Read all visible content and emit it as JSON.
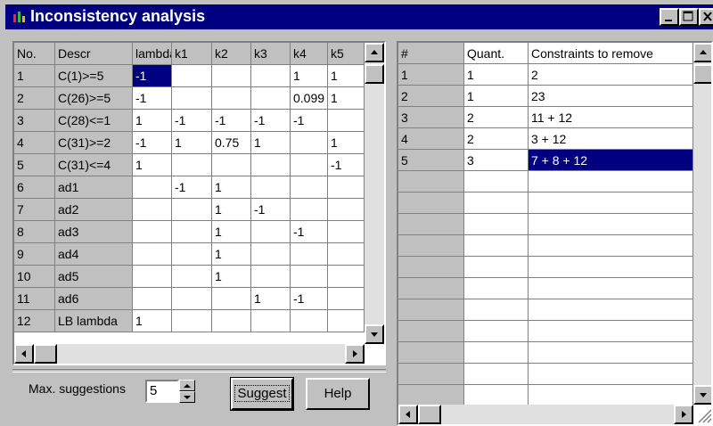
{
  "window": {
    "title": "Inconsistency analysis",
    "minimize_icon": "minimize-icon",
    "maximize_icon": "maximize-icon",
    "close_icon": "close-icon"
  },
  "left_grid": {
    "headers": [
      "No.",
      "Descr",
      "lambda",
      "k1",
      "k2",
      "k3",
      "k4",
      "k5"
    ],
    "rows": [
      [
        "1",
        "C(1)>=5",
        "-1",
        "",
        "",
        "",
        "1",
        "1"
      ],
      [
        "2",
        "C(26)>=5",
        "-1",
        "",
        "",
        "",
        "0.099",
        "1"
      ],
      [
        "3",
        "C(28)<=1",
        "1",
        "-1",
        "-1",
        "-1",
        "-1",
        ""
      ],
      [
        "4",
        "C(31)>=2",
        "-1",
        "1",
        "0.75",
        "1",
        "",
        "1"
      ],
      [
        "5",
        "C(31)<=4",
        "1",
        "",
        "",
        "",
        "",
        "-1"
      ],
      [
        "6",
        "ad1",
        "",
        "-1",
        "1",
        "",
        "",
        ""
      ],
      [
        "7",
        "ad2",
        "",
        "",
        "1",
        "-1",
        "",
        ""
      ],
      [
        "8",
        "ad3",
        "",
        "",
        "1",
        "",
        "-1",
        ""
      ],
      [
        "9",
        "ad4",
        "",
        "",
        "1",
        "",
        "",
        ""
      ],
      [
        "10",
        "ad5",
        "",
        "",
        "1",
        "",
        "",
        ""
      ],
      [
        "11",
        "ad6",
        "",
        "",
        "",
        "1",
        "-1",
        ""
      ],
      [
        "12",
        "LB lambda",
        "1",
        "",
        "",
        "",
        "",
        ""
      ]
    ]
  },
  "right_grid": {
    "headers": [
      "#",
      "Quant.",
      "Constraints to remove"
    ],
    "rows": [
      [
        "1",
        "1",
        "2"
      ],
      [
        "2",
        "1",
        "23"
      ],
      [
        "3",
        "2",
        "11 + 12"
      ],
      [
        "4",
        "2",
        "3 + 12"
      ],
      [
        "5",
        "3",
        "7 + 8 + 12"
      ],
      [
        "",
        "",
        ""
      ],
      [
        "",
        "",
        ""
      ],
      [
        "",
        "",
        ""
      ],
      [
        "",
        "",
        ""
      ],
      [
        "",
        "",
        ""
      ],
      [
        "",
        "",
        ""
      ],
      [
        "",
        "",
        ""
      ],
      [
        "",
        "",
        ""
      ],
      [
        "",
        "",
        ""
      ],
      [
        "",
        "",
        ""
      ],
      [
        "",
        "",
        ""
      ],
      [
        "",
        "",
        ""
      ]
    ]
  },
  "controls": {
    "max_suggestions_label": "Max. suggestions",
    "max_suggestions_value": "5",
    "suggest_label": "Suggest",
    "help_label": "Help"
  }
}
